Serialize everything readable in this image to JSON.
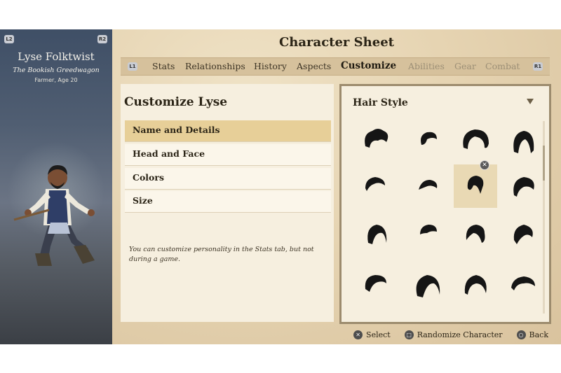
{
  "character": {
    "name": "Lyse Folktwist",
    "title": "The Bookish Greedwagon",
    "subtitle": "Farmer, Age 20",
    "shoulder_left": "L2",
    "shoulder_right": "R2"
  },
  "page_title": "Character Sheet",
  "tabs": {
    "bumper_left": "L1",
    "bumper_right": "R1",
    "items": [
      {
        "label": "Stats",
        "state": "normal"
      },
      {
        "label": "Relationships",
        "state": "normal"
      },
      {
        "label": "History",
        "state": "normal"
      },
      {
        "label": "Aspects",
        "state": "normal"
      },
      {
        "label": "Customize",
        "state": "active"
      },
      {
        "label": "Abilities",
        "state": "disabled"
      },
      {
        "label": "Gear",
        "state": "disabled"
      },
      {
        "label": "Combat",
        "state": "disabled"
      }
    ]
  },
  "customize": {
    "heading": "Customize Lyse",
    "items": [
      {
        "label": "Name and Details",
        "selected": true
      },
      {
        "label": "Head and Face",
        "selected": false
      },
      {
        "label": "Colors",
        "selected": false
      },
      {
        "label": "Size",
        "selected": false
      }
    ],
    "note": "You can customize personality in the Stats tab, but not during a game."
  },
  "hair_style": {
    "heading": "Hair Style",
    "dropdown_icon": "triangle-down-icon",
    "selected_index": 6,
    "remove_glyph": "✕",
    "count": 16
  },
  "controls": [
    {
      "glyph": "✕",
      "label": "Select"
    },
    {
      "glyph": "□",
      "label": "Randomize Character"
    },
    {
      "glyph": "○",
      "label": "Back"
    }
  ],
  "colors": {
    "parchment": "#e6d4b2",
    "selection": "#e7cf98",
    "hair": "#151515"
  }
}
